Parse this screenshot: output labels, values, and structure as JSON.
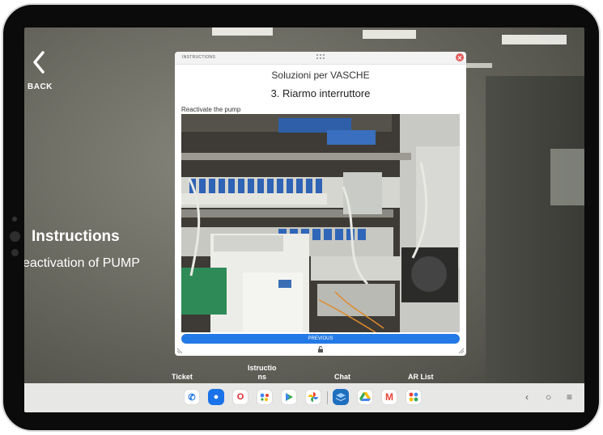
{
  "nav": {
    "back_label": "BACK"
  },
  "sidebar": {
    "title": "Instructions",
    "subtitle": "eactivation of PUMP"
  },
  "panel": {
    "header_label": "INSTRUCTIONS",
    "heading": "Soluzioni per VASCHE",
    "step": "3. Riarmo interruttore",
    "caption": "Reactivate the pump",
    "previous_label": "PREVIOUS"
  },
  "menu": {
    "ticket": "Ticket",
    "instructions_line1": "Istructio",
    "instructions_line2": "ns",
    "chat": "Chat",
    "ar_list": "AR List"
  },
  "taskbar": {
    "apps": [
      {
        "icon": "phone-icon",
        "glyph": "✆",
        "color": "#ffffff"
      },
      {
        "icon": "messages-icon",
        "glyph": "💬",
        "color": "#1a73e8"
      },
      {
        "icon": "opera-icon",
        "glyph": "O",
        "color": "#e0252c"
      },
      {
        "icon": "assistant-icon",
        "glyph": "●",
        "color": "#ffffff"
      },
      {
        "icon": "play-store-icon",
        "glyph": "▶",
        "color": "#ffffff"
      },
      {
        "icon": "photos-icon",
        "glyph": "✿",
        "color": "#ffffff"
      },
      {
        "icon": "ar-app-icon",
        "glyph": "◈",
        "color": "#1f6fbf"
      },
      {
        "icon": "drive-icon",
        "glyph": "▲",
        "color": "#ffffff"
      },
      {
        "icon": "gmail-icon",
        "glyph": "M",
        "color": "#ffffff"
      },
      {
        "icon": "app-drawer-icon",
        "glyph": "⠿",
        "color": "#ffffff"
      }
    ],
    "nav_back": "‹",
    "nav_home": "○",
    "nav_menu": "≡"
  },
  "colors": {
    "accent": "#2379e6",
    "close": "#e45b5b",
    "taskbar": "#e7e7e6"
  }
}
